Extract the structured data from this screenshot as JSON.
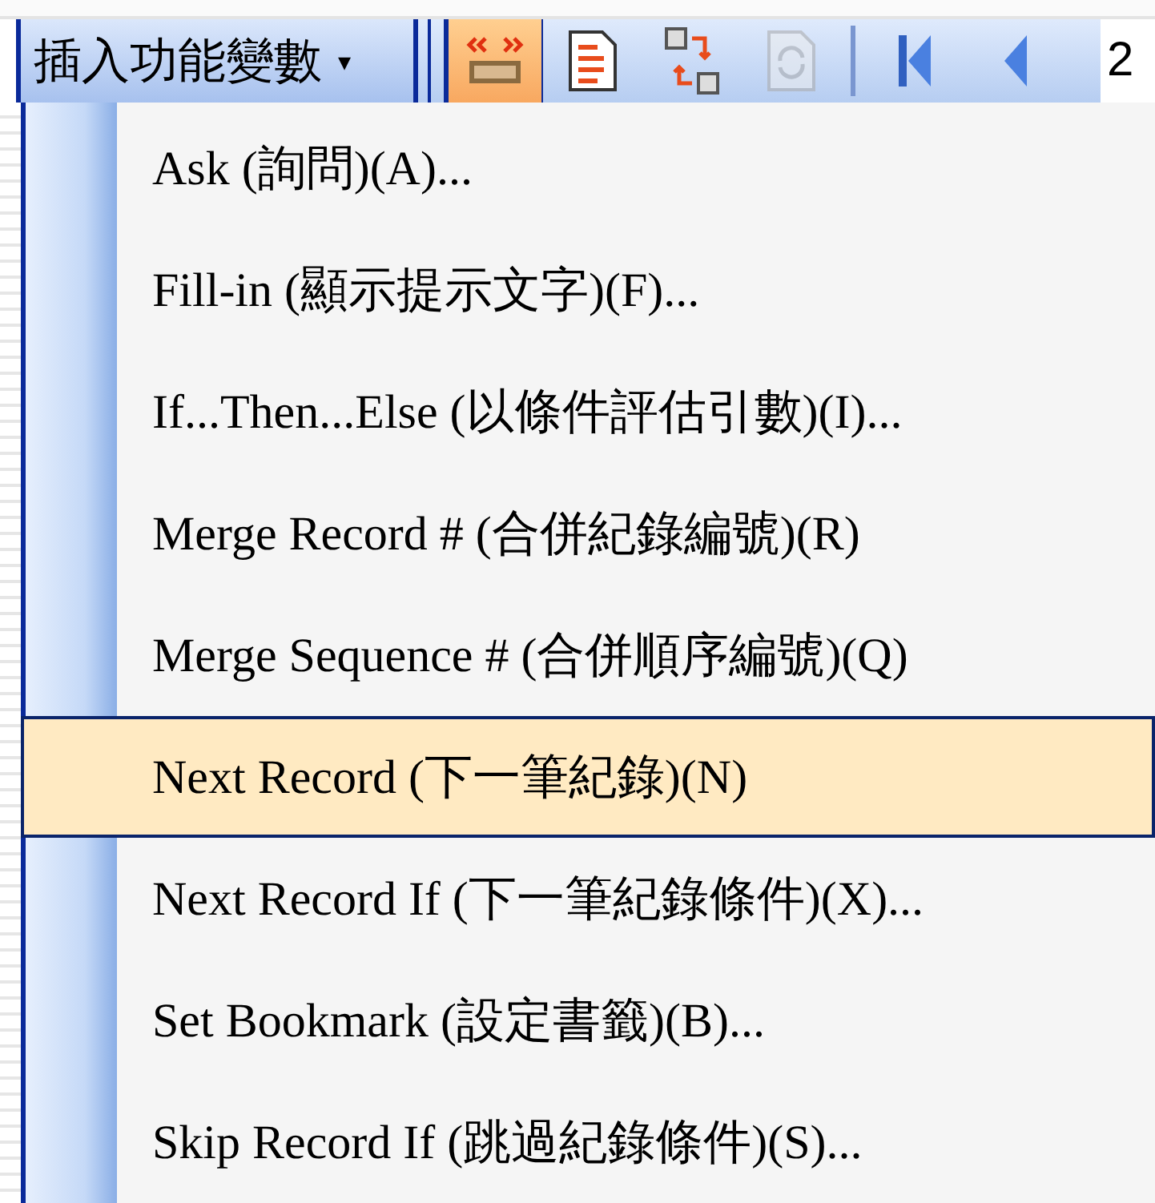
{
  "toolbar": {
    "dropdown": {
      "label": "插入功能變數",
      "caret": "▾"
    },
    "buttons": [
      {
        "kind": "abc",
        "selected": true,
        "disabled": false
      },
      {
        "kind": "document",
        "selected": false,
        "disabled": false
      },
      {
        "kind": "arrows",
        "selected": false,
        "disabled": false
      },
      {
        "kind": "refresh",
        "selected": false,
        "disabled": true
      },
      {
        "kind": "first",
        "selected": false,
        "disabled": false
      },
      {
        "kind": "previous",
        "selected": false,
        "disabled": false
      }
    ],
    "record_field": {
      "value": "2"
    }
  },
  "menu": {
    "items": [
      {
        "label": "Ask (詢問)(A)...",
        "selected": false
      },
      {
        "label": "Fill-in (顯示提示文字)(F)...",
        "selected": false
      },
      {
        "label": "If...Then...Else (以條件評估引數)(I)...",
        "selected": false
      },
      {
        "label": "Merge Record # (合併紀錄編號)(R)",
        "selected": false
      },
      {
        "label": "Merge Sequence # (合併順序編號)(Q)",
        "selected": false
      },
      {
        "label": "Next Record (下一筆紀錄)(N)",
        "selected": true
      },
      {
        "label": "Next Record If (下一筆紀錄條件)(X)...",
        "selected": false
      },
      {
        "label": "Set Bookmark (設定書籤)(B)...",
        "selected": false
      },
      {
        "label": "Skip Record If (跳過紀錄條件)(S)...",
        "selected": false
      }
    ]
  }
}
